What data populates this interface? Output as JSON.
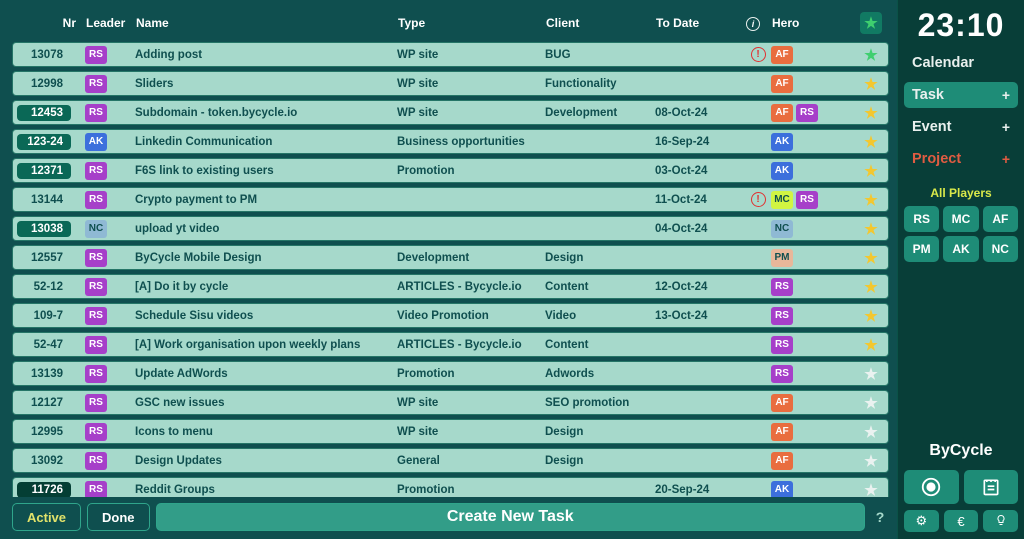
{
  "header": {
    "nr": "Nr",
    "leader": "Leader",
    "name": "Name",
    "type": "Type",
    "client": "Client",
    "to_date": "To Date",
    "hero": "Hero"
  },
  "rows": [
    {
      "nr": "13078",
      "nr_style": "default",
      "leader": "RS",
      "name": "Adding post",
      "type": "WP site",
      "client": "BUG",
      "to_date": "",
      "info": "red",
      "hero": [
        "AF"
      ],
      "star": "green"
    },
    {
      "nr": "12998",
      "nr_style": "default",
      "leader": "RS",
      "name": "Sliders",
      "type": "WP site",
      "client": "Functionality",
      "to_date": "",
      "info": "",
      "hero": [
        "AF"
      ],
      "star": "yellow"
    },
    {
      "nr": "12453",
      "nr_style": "green",
      "leader": "RS",
      "name": "Subdomain - token.bycycle.io",
      "type": "WP site",
      "client": "Development",
      "to_date": "08-Oct-24",
      "info": "",
      "hero": [
        "AF",
        "RS"
      ],
      "star": "yellow"
    },
    {
      "nr": "123-24",
      "nr_style": "green",
      "leader": "AK",
      "name": "Linkedin Communication",
      "type": "Business opportunities",
      "client": "",
      "to_date": "16-Sep-24",
      "info": "",
      "hero": [
        "AK"
      ],
      "star": "yellow"
    },
    {
      "nr": "12371",
      "nr_style": "green",
      "leader": "RS",
      "name": "F6S link to existing users",
      "type": "Promotion",
      "client": "",
      "to_date": "03-Oct-24",
      "info": "",
      "hero": [
        "AK"
      ],
      "star": "yellow"
    },
    {
      "nr": "13144",
      "nr_style": "default",
      "leader": "RS",
      "name": "Crypto payment to PM",
      "type": "",
      "client": "",
      "to_date": "11-Oct-24",
      "info": "red",
      "hero": [
        "MC",
        "RS"
      ],
      "star": "yellow"
    },
    {
      "nr": "13038",
      "nr_style": "green",
      "leader": "NC",
      "name": "upload yt video",
      "type": "",
      "client": "",
      "to_date": "04-Oct-24",
      "info": "",
      "hero": [
        "NC"
      ],
      "star": "yellow"
    },
    {
      "nr": "12557",
      "nr_style": "default",
      "leader": "RS",
      "name": "ByCycle Mobile Design",
      "type": "Development",
      "client": "Design",
      "to_date": "",
      "info": "",
      "hero": [
        "PM"
      ],
      "star": "yellow"
    },
    {
      "nr": "52-12",
      "nr_style": "default",
      "leader": "RS",
      "name": "[A] Do it by cycle",
      "type": "ARTICLES - Bycycle.io",
      "client": "Content",
      "to_date": "12-Oct-24",
      "info": "",
      "hero": [
        "RS"
      ],
      "star": "yellow"
    },
    {
      "nr": "109-7",
      "nr_style": "default",
      "leader": "RS",
      "name": "Schedule Sisu videos",
      "type": "Video Promotion",
      "client": "Video",
      "to_date": "13-Oct-24",
      "info": "",
      "hero": [
        "RS"
      ],
      "star": "yellow"
    },
    {
      "nr": "52-47",
      "nr_style": "default",
      "leader": "RS",
      "name": "[A] Work organisation upon weekly plans",
      "type": "ARTICLES - Bycycle.io",
      "client": "Content",
      "to_date": "",
      "info": "",
      "hero": [
        "RS"
      ],
      "star": "yellow"
    },
    {
      "nr": "13139",
      "nr_style": "default",
      "leader": "RS",
      "name": "Update AdWords",
      "type": "Promotion",
      "client": "Adwords",
      "to_date": "",
      "info": "",
      "hero": [
        "RS"
      ],
      "star": "white"
    },
    {
      "nr": "12127",
      "nr_style": "default",
      "leader": "RS",
      "name": "GSC new issues",
      "type": "WP site",
      "client": "SEO promotion",
      "to_date": "",
      "info": "",
      "hero": [
        "AF"
      ],
      "star": "white"
    },
    {
      "nr": "12995",
      "nr_style": "default",
      "leader": "RS",
      "name": "Icons to menu",
      "type": "WP site",
      "client": "Design",
      "to_date": "",
      "info": "",
      "hero": [
        "AF"
      ],
      "star": "white"
    },
    {
      "nr": "13092",
      "nr_style": "default",
      "leader": "RS",
      "name": "Design Updates",
      "type": "General",
      "client": "Design",
      "to_date": "",
      "info": "",
      "hero": [
        "AF"
      ],
      "star": "white"
    },
    {
      "nr": "11726",
      "nr_style": "darkgreen",
      "leader": "RS",
      "name": "Reddit Groups",
      "type": "Promotion",
      "client": "",
      "to_date": "20-Sep-24",
      "info": "",
      "hero": [
        "AK"
      ],
      "star": "white"
    }
  ],
  "footer": {
    "active": "Active",
    "done": "Done",
    "create": "Create New Task",
    "help": "?"
  },
  "sidebar": {
    "clock": "23:10",
    "calendar": "Calendar",
    "task": "Task",
    "event": "Event",
    "project": "Project",
    "plus": "+",
    "all_players": "All Players",
    "players": [
      "RS",
      "MC",
      "AF",
      "PM",
      "AK",
      "NC"
    ],
    "brand": "ByCycle",
    "gear": "⚙",
    "euro": "€",
    "bulb": "💡"
  }
}
